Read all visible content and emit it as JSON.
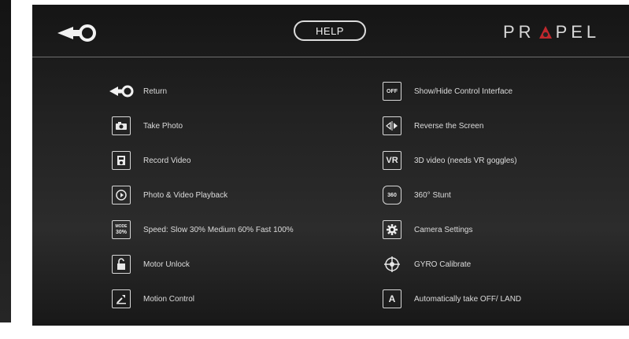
{
  "header": {
    "help_label": "HELP",
    "brand": {
      "pre": "PR",
      "post": "PEL"
    }
  },
  "left_items": [
    {
      "icon": "return-icon",
      "label": "Return"
    },
    {
      "icon": "camera-icon",
      "label": "Take Photo"
    },
    {
      "icon": "record-video-icon",
      "label": "Record Video"
    },
    {
      "icon": "playback-icon",
      "label": "Photo & Video Playback"
    },
    {
      "icon": "speed-icon",
      "icon_top": "MODE",
      "icon_text": "30%",
      "label": "Speed: Slow 30% Medium 60% Fast 100%"
    },
    {
      "icon": "lock-icon",
      "label": "Motor Unlock"
    },
    {
      "icon": "motion-control-icon",
      "label": "Motion Control"
    }
  ],
  "right_items": [
    {
      "icon": "off-icon",
      "icon_text": "OFF",
      "label": "Show/Hide Control Interface"
    },
    {
      "icon": "reverse-screen-icon",
      "label": "Reverse the Screen"
    },
    {
      "icon": "vr-icon",
      "icon_text": "VR",
      "label": "3D video (needs VR goggles)"
    },
    {
      "icon": "stunt-360-icon",
      "icon_text": "360",
      "label": "360° Stunt"
    },
    {
      "icon": "gear-icon",
      "label": "Camera Settings"
    },
    {
      "icon": "gyro-icon",
      "label": "GYRO Calibrate"
    },
    {
      "icon": "takeoff-land-icon",
      "icon_text": "A",
      "label": "Automatically take OFF/ LAND"
    }
  ],
  "colors": {
    "background": "#222222",
    "foreground": "#e8e8e8",
    "accent": "#c0282d"
  }
}
